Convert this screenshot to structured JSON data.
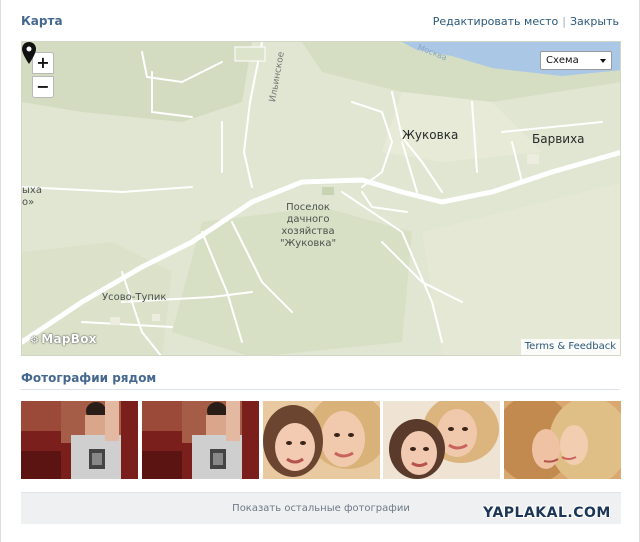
{
  "header": {
    "title": "Карта",
    "edit_link": "Редактировать место",
    "separator": "|",
    "close_link": "Закрыть"
  },
  "map": {
    "zoom_in": "+",
    "zoom_out": "−",
    "layer_select": "Схема",
    "labels": {
      "zhukovka": "Жуковка",
      "barvikha": "Барвиха",
      "usovo_tupik": "Усово-Тупик",
      "poselok_line1": "Поселок",
      "poselok_line2": "дачного",
      "poselok_line3": "хозяйства",
      "poselok_line4": "\"Жуковка\"",
      "road": "Ильинское",
      "river": "Москва",
      "left_cut_1": "ыха",
      "left_cut_2": "о»"
    },
    "logo": "MapBox",
    "attribution": "Terms & Feedback"
  },
  "photos": {
    "title": "Фотографии рядом",
    "show_more": "Показать остальные фотографии",
    "items": [
      {
        "name": "photo-1",
        "kind": "mirror-selfie"
      },
      {
        "name": "photo-2",
        "kind": "mirror-selfie"
      },
      {
        "name": "photo-3",
        "kind": "mother-daughter"
      },
      {
        "name": "photo-4",
        "kind": "mother-daughter"
      },
      {
        "name": "photo-5",
        "kind": "mother-daughter-profile"
      }
    ]
  },
  "watermark": "YAPLAKAL.COM",
  "colors": {
    "accent": "#45688e",
    "link": "#2b587a",
    "map_bg": "#dfe5cf",
    "road": "#ffffff",
    "water": "#a9c6e6"
  }
}
